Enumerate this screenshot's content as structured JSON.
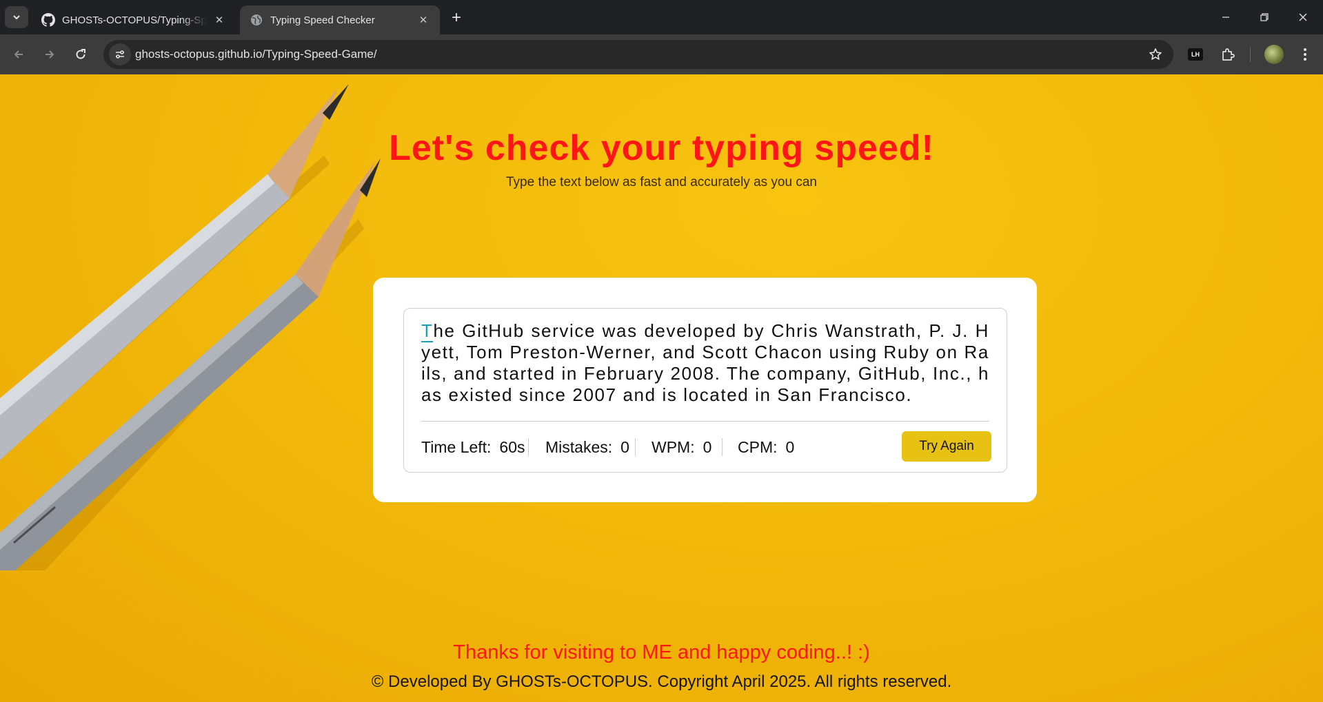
{
  "browser": {
    "tabs": [
      {
        "title": "GHOSTs-OCTOPUS/Typing-Speed-Game",
        "icon": "github-icon"
      },
      {
        "title": "Typing Speed Checker",
        "icon": "globe-icon"
      }
    ],
    "url": "ghosts-octopus.github.io/Typing-Speed-Game/",
    "lighthouse_label": "LH"
  },
  "page": {
    "headline": "Let's check your typing speed!",
    "subline": "Type the text below as fast and accurately as you can",
    "passage_first_char": "T",
    "passage_rest": "he GitHub service was developed by Chris Wanstrath, P. J. Hyett, Tom Preston-Werner, and Scott Chacon using Ruby on Rails, and started in February 2008. The company, GitHub, Inc., has existed since 2007 and is located in San Francisco.",
    "stats": {
      "time_label": "Time Left:",
      "time_value": "60s",
      "mistakes_label": "Mistakes:",
      "mistakes_value": "0",
      "wpm_label": "WPM:",
      "wpm_value": "0",
      "cpm_label": "CPM:",
      "cpm_value": "0"
    },
    "try_again_label": "Try Again",
    "thanks": "Thanks for visiting to ME and happy coding..! :)",
    "footer": "© Developed By GHOSTs-OCTOPUS. Copyright April 2025. All rights reserved."
  },
  "colors": {
    "background": "#f2b90a",
    "headline": "#ff1515",
    "accent_button": "#e8c212",
    "cursor_char": "#14a1b8"
  }
}
